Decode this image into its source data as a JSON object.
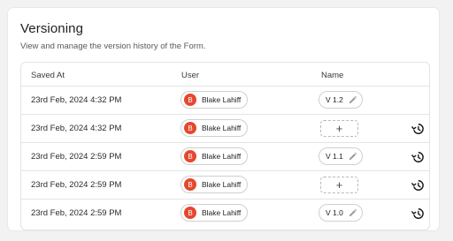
{
  "page": {
    "title": "Versioning",
    "subtitle": "View and manage the version history of the Form."
  },
  "table": {
    "headers": {
      "saved_at": "Saved At",
      "user": "User",
      "name": "Name"
    },
    "rows": [
      {
        "saved_at": "23rd Feb, 2024 4:32 PM",
        "user_initial": "B",
        "user": "Blake Lahiff",
        "name": "V 1.2",
        "restorable": false
      },
      {
        "saved_at": "23rd Feb, 2024 4:32 PM",
        "user_initial": "B",
        "user": "Blake Lahiff",
        "name": "+",
        "restorable": true
      },
      {
        "saved_at": "23rd Feb, 2024 2:59 PM",
        "user_initial": "B",
        "user": "Blake Lahiff",
        "name": "V 1.1",
        "restorable": true
      },
      {
        "saved_at": "23rd Feb, 2024 2:59 PM",
        "user_initial": "B",
        "user": "Blake Lahiff",
        "name": "+",
        "restorable": true
      },
      {
        "saved_at": "23rd Feb, 2024 2:59 PM",
        "user_initial": "B",
        "user": "Blake Lahiff",
        "name": "V 1.0",
        "restorable": true
      }
    ]
  },
  "icons": {
    "edit": "pencil-icon",
    "restore": "history-icon"
  },
  "colors": {
    "avatar": "#e5482e",
    "border": "#e4e4e4",
    "background": "#f2f2f2"
  }
}
